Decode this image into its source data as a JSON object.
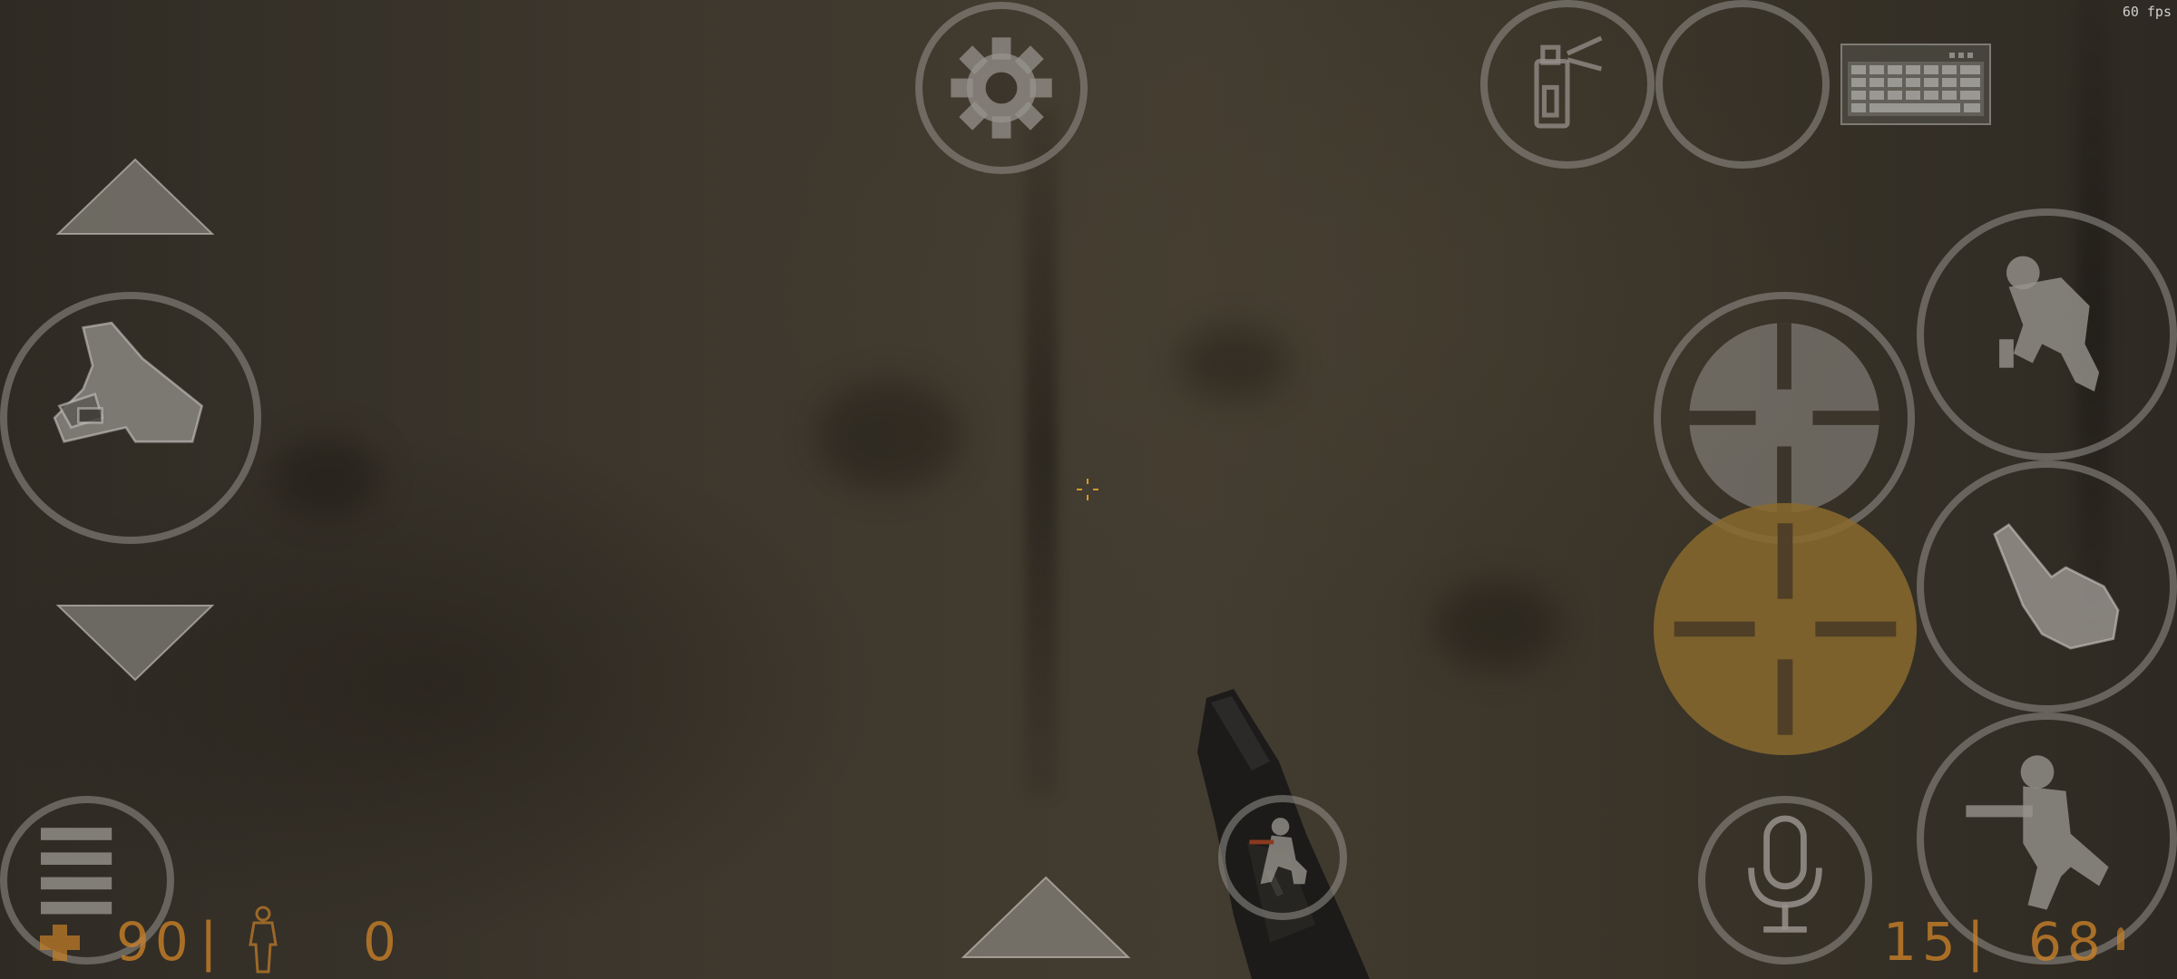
{
  "hud": {
    "fps": "60 fps",
    "health": "90",
    "armor": "0",
    "ammo_clip": "15",
    "ammo_reserve": "68",
    "separator": "|"
  },
  "colors": {
    "hud_orange": "#c88028",
    "button_gray": "#96928c",
    "attack2_fill": "#8a6a2e"
  },
  "controls": {
    "settings": "gear-icon",
    "spray": "spray-can-icon",
    "empty_slot": "empty",
    "console": "keyboard-icon",
    "look_up": "triangle-up-icon",
    "look_down": "triangle-down-icon",
    "flashlight": "hev-suit-flashlight-icon",
    "menu": "hamburger-icon",
    "crouch_toggle": "crouch-icon",
    "next_weapon": "triangle-up-icon",
    "attack": "crosshair-icon",
    "attack2": "crosshair-icon",
    "jump": "jump-icon",
    "use": "hand-pointer-icon",
    "duck": "duck-icon",
    "voice": "microphone-icon"
  }
}
